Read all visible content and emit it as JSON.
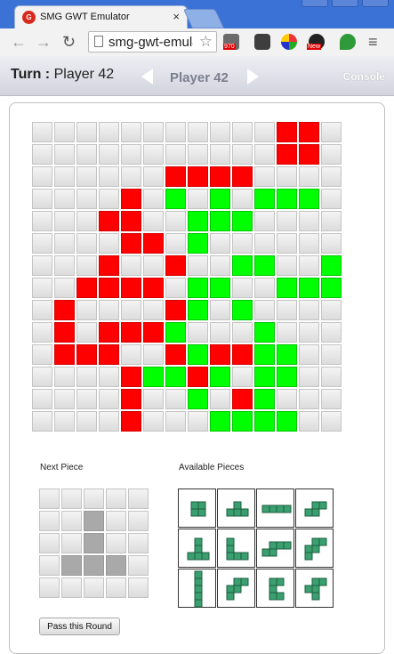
{
  "browser": {
    "tab_title": "SMG GWT Emulator",
    "tab_close": "×",
    "url": "smg-gwt-emulator",
    "ext_badge_970": "970",
    "ext_badge_new": "New"
  },
  "header": {
    "turn_label": "Turn :",
    "turn_player": "Player 42",
    "center_player": "Player 42",
    "console_label": "Console"
  },
  "board": {
    "rows": 14,
    "cols": 14,
    "grid": [
      "...........RR.",
      "...........RR.",
      "......RRRR....",
      "....R.G.G.GGG.",
      "...RR..GGG....",
      "....RR.G......",
      "...R..R..GG..G",
      "..RRRR.GG..GGG",
      ".R....RG.G....",
      ".R.RRRG...G...",
      ".RRR..RGRRGG..",
      "....RGGRG.GG..",
      "....R..G.RG...",
      "....R...GGGG.."
    ],
    "colors": {
      "red": "#ff0000",
      "green": "#00ff00",
      "empty": "#e8e8e8"
    }
  },
  "next_piece": {
    "label": "Next Piece",
    "grid": [
      ".....",
      "..X..",
      "..X..",
      ".XXX.",
      "....."
    ]
  },
  "available": {
    "label": "Available Pieces",
    "color": "#3aa070",
    "pieces": [
      {
        "name": "square",
        "cells": [
          [
            0,
            0
          ],
          [
            1,
            0
          ],
          [
            0,
            1
          ],
          [
            1,
            1
          ]
        ]
      },
      {
        "name": "t-shape",
        "cells": [
          [
            1,
            0
          ],
          [
            0,
            1
          ],
          [
            1,
            1
          ],
          [
            2,
            1
          ]
        ]
      },
      {
        "name": "bar-4",
        "cells": [
          [
            0,
            0
          ],
          [
            1,
            0
          ],
          [
            2,
            0
          ],
          [
            3,
            0
          ]
        ]
      },
      {
        "name": "s-shape",
        "cells": [
          [
            1,
            0
          ],
          [
            2,
            0
          ],
          [
            0,
            1
          ],
          [
            1,
            1
          ]
        ]
      },
      {
        "name": "l-left",
        "cells": [
          [
            1,
            0
          ],
          [
            1,
            1
          ],
          [
            0,
            2
          ],
          [
            1,
            2
          ],
          [
            2,
            2
          ]
        ]
      },
      {
        "name": "l-right",
        "cells": [
          [
            0,
            0
          ],
          [
            0,
            1
          ],
          [
            0,
            2
          ],
          [
            1,
            2
          ],
          [
            2,
            2
          ]
        ]
      },
      {
        "name": "z-long",
        "cells": [
          [
            1,
            0
          ],
          [
            2,
            0
          ],
          [
            3,
            0
          ],
          [
            0,
            1
          ],
          [
            1,
            1
          ]
        ]
      },
      {
        "name": "p-shape",
        "cells": [
          [
            1,
            0
          ],
          [
            2,
            0
          ],
          [
            0,
            1
          ],
          [
            1,
            1
          ],
          [
            0,
            2
          ]
        ]
      },
      {
        "name": "i-5",
        "cells": [
          [
            0,
            0
          ],
          [
            0,
            1
          ],
          [
            0,
            2
          ],
          [
            0,
            3
          ],
          [
            0,
            4
          ]
        ]
      },
      {
        "name": "w-shape",
        "cells": [
          [
            1,
            0
          ],
          [
            2,
            0
          ],
          [
            0,
            1
          ],
          [
            1,
            1
          ],
          [
            0,
            2
          ]
        ]
      },
      {
        "name": "c-shape",
        "cells": [
          [
            0,
            0
          ],
          [
            1,
            0
          ],
          [
            0,
            1
          ],
          [
            0,
            2
          ],
          [
            1,
            2
          ]
        ]
      },
      {
        "name": "f-shape",
        "cells": [
          [
            1,
            0
          ],
          [
            2,
            0
          ],
          [
            0,
            1
          ],
          [
            1,
            1
          ],
          [
            1,
            2
          ]
        ]
      }
    ]
  },
  "actions": {
    "pass_label": "Pass this Round"
  }
}
